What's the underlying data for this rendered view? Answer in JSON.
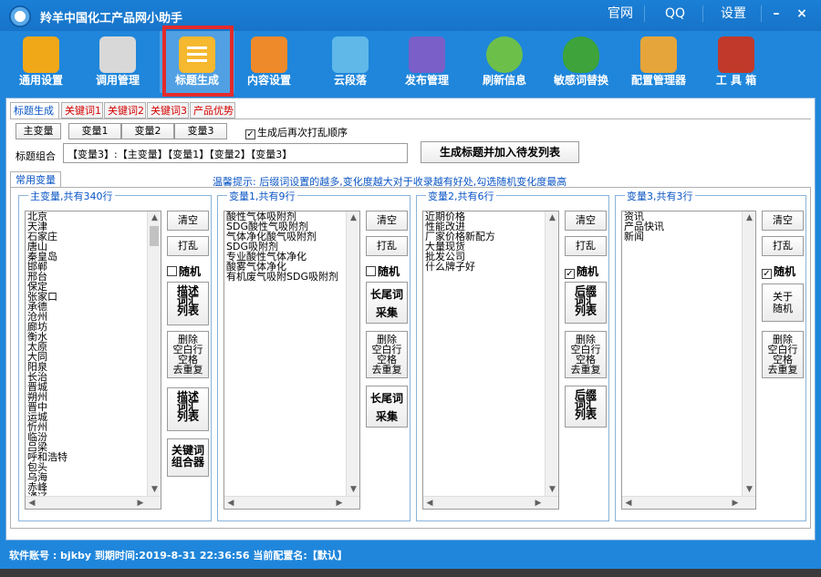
{
  "window": {
    "title": "羚羊中国化工产品网小助手",
    "links": [
      "官网",
      "QQ",
      "设置"
    ],
    "minimize": "–",
    "close": "×"
  },
  "toolbar": {
    "items": [
      {
        "label": "通用设置",
        "icon": "tools-icon",
        "color": "#f0a818"
      },
      {
        "label": "调用管理",
        "icon": "clipboard-pencil-icon",
        "color": "#d8d8d8"
      },
      {
        "label": "标题生成",
        "icon": "list-icon",
        "color": "#f5b82e"
      },
      {
        "label": "内容设置",
        "icon": "folder-hammer-icon",
        "color": "#ee8a2a"
      },
      {
        "label": "云段落",
        "icon": "cloud-check-icon",
        "color": "#5fb8e8"
      },
      {
        "label": "发布管理",
        "icon": "computer-icon",
        "color": "#7a5fc8"
      },
      {
        "label": "刷新信息",
        "icon": "refresh-icon",
        "color": "#6cc04a"
      },
      {
        "label": "敏感词替换",
        "icon": "shield-check-icon",
        "color": "#3da33a"
      },
      {
        "label": "配置管理器",
        "icon": "package-icon",
        "color": "#e6a53a"
      },
      {
        "label": "工 具 箱",
        "icon": "toolbox-icon",
        "color": "#c0392b"
      }
    ]
  },
  "subtabs": [
    "标题生成",
    "关键词1",
    "关键词2",
    "关键词3",
    "产品优势"
  ],
  "vars": {
    "buttons": [
      "主变量",
      "变量1",
      "变量2",
      "变量3"
    ],
    "shuffle_label": "生成后再次打乱顺序",
    "combo_label": "标题组合",
    "combo_value": "【变量3】:【主变量】【变量1】【变量2】【变量3】",
    "generate_label": "生成标题并加入待发列表"
  },
  "common_tab": "常用变量",
  "tip": "温馨提示: 后缀词设置的越多,变化度越大对于收录越有好处,勾选随机变化度最高",
  "groups": {
    "main": {
      "title": "主变量,共有340行",
      "items": [
        "北京",
        "天津",
        "石家庄",
        "唐山",
        "秦皇岛",
        "邯郸",
        "邢台",
        "保定",
        "张家口",
        "承德",
        "沧州",
        "廊坊",
        "衡水",
        "太原",
        "大同",
        "阳泉",
        "长治",
        "晋城",
        "朔州",
        "晋中",
        "运城",
        "忻州",
        "临汾",
        "吕梁",
        "呼和浩特",
        "包头",
        "乌海",
        "赤峰",
        "通辽"
      ],
      "clear": "清空",
      "shuffle": "打乱",
      "random": "随机",
      "desc_list": [
        "描述",
        "词汇",
        "列表"
      ],
      "delete_blank": [
        "删除",
        "空白行",
        "空格",
        "去重复"
      ],
      "desc_list2": [
        "描述",
        "词汇",
        "列表"
      ],
      "combiner": [
        "关键词",
        "组合器"
      ]
    },
    "v1": {
      "title": "变量1,共有9行",
      "items": [
        "酸性气体吸附剂",
        "SDG酸性气吸附剂",
        "气体净化酸气吸附剂",
        "SDG吸附剂",
        "专业酸性气体净化",
        "酸雾气体净化",
        "有机废气吸附SDG吸附剂"
      ],
      "clear": "清空",
      "shuffle": "打乱",
      "random": "随机",
      "longtail": "长尾词",
      "collect": "采集",
      "delete_blank": [
        "删除",
        "空白行",
        "空格",
        "去重复"
      ],
      "longtail2": "长尾词",
      "collect2": "采集"
    },
    "v2": {
      "title": "变量2,共有6行",
      "items": [
        "近期价格",
        "性能改进",
        "厂家价格新配方",
        "大量现货",
        "批发公司",
        "什么牌子好"
      ],
      "clear": "清空",
      "shuffle": "打乱",
      "random": "随机",
      "suffix_list": [
        "后缀",
        "词汇",
        "列表"
      ],
      "delete_blank": [
        "删除",
        "空白行",
        "空格",
        "去重复"
      ],
      "suffix_list2": [
        "后缀",
        "词汇",
        "列表"
      ]
    },
    "v3": {
      "title": "变量3,共有3行",
      "items": [
        "资讯",
        "产品快讯",
        "新闻"
      ],
      "clear": "清空",
      "shuffle": "打乱",
      "random": "随机",
      "about_random": [
        "关于",
        "随机"
      ],
      "delete_blank": [
        "删除",
        "空白行",
        "空格",
        "去重复"
      ]
    }
  },
  "status": {
    "text": "软件账号 : bjkby 到期时间:2019-8-31 22:36:56 当前配置名:【默认】"
  }
}
